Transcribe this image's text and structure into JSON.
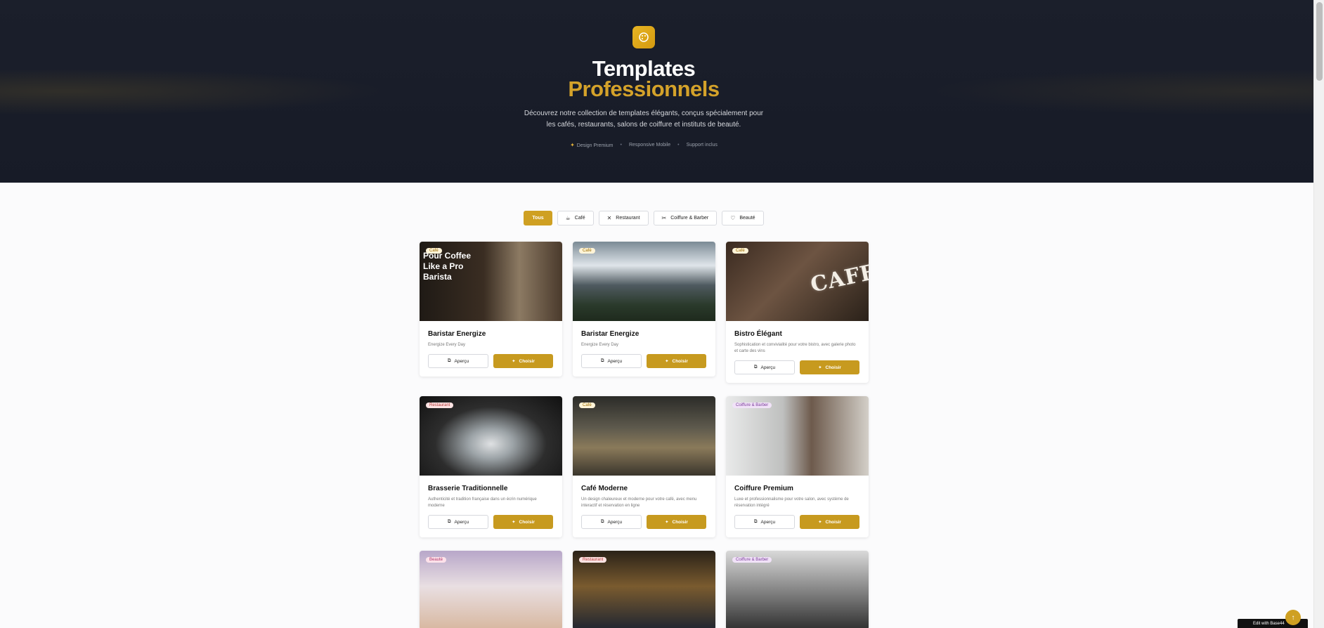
{
  "hero": {
    "logo_icon": "palette-icon",
    "title_line1": "Templates",
    "title_line2": "Professionnels",
    "description": "Découvrez notre collection de templates élégants, conçus spécialement pour les cafés, restaurants, salons de coiffure et instituts de beauté.",
    "features": [
      "Design Premium",
      "Responsive Mobile",
      "Support inclus"
    ]
  },
  "filters": [
    {
      "label": "Tous",
      "icon": "",
      "active": true
    },
    {
      "label": "Café",
      "icon": "coffee-icon"
    },
    {
      "label": "Restaurant",
      "icon": "utensils-icon"
    },
    {
      "label": "Coiffure & Barber",
      "icon": "scissors-icon"
    },
    {
      "label": "Beauté",
      "icon": "heart-icon"
    }
  ],
  "buttons": {
    "preview": "Aperçu",
    "choose": "Choisir"
  },
  "cards": [
    {
      "tag": "Café",
      "title": "Baristar Energize",
      "desc": "Energize Every Day",
      "image_text": [
        "Pour Coffee",
        "Like a Pro",
        "Barista"
      ]
    },
    {
      "tag": "Café",
      "title": "Baristar Energize",
      "desc": "Energize Every Day"
    },
    {
      "tag": "Café",
      "title": "Bistro Élégant",
      "desc": "Sophistication et convivialité pour votre bistro, avec galerie photo et carte des vins",
      "image_text": "CAFE"
    },
    {
      "tag": "Restaurant",
      "title": "Brasserie Traditionnelle",
      "desc": "Authenticité et tradition française dans un écrin numérique moderne"
    },
    {
      "tag": "Café",
      "title": "Café Moderne",
      "desc": "Un design chaleureux et moderne pour votre café, avec menu interactif et réservation en ligne"
    },
    {
      "tag": "Coiffure & Barber",
      "title": "Coiffure Premium",
      "desc": "Luxe et professionnalisme pour votre salon, avec système de réservation intégré"
    },
    {
      "tag": "Beauté"
    },
    {
      "tag": "Restaurant"
    },
    {
      "tag": "Coiffure & Barber"
    }
  ],
  "edit_badge": "Edit with Base44"
}
